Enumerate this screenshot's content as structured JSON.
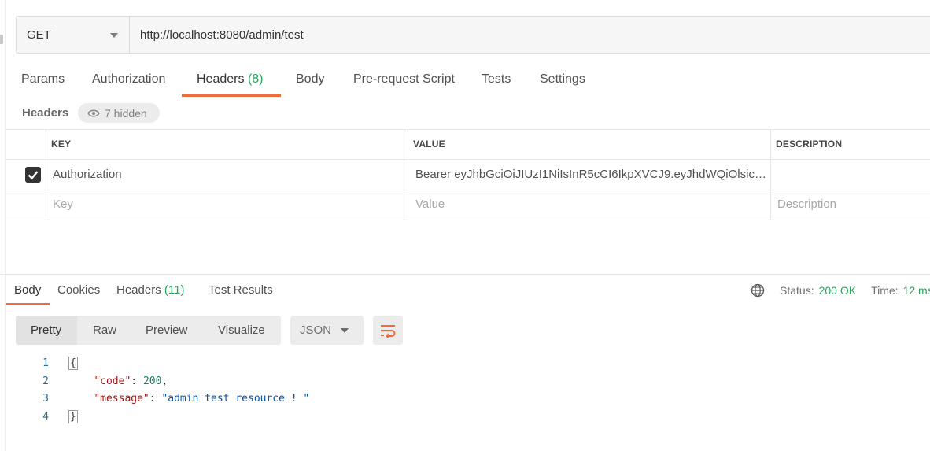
{
  "request": {
    "method": "GET",
    "url": "http://localhost:8080/admin/test"
  },
  "request_tabs": [
    {
      "label": "Params"
    },
    {
      "label": "Authorization"
    },
    {
      "label": "Headers",
      "count": "(8)"
    },
    {
      "label": "Body"
    },
    {
      "label": "Pre-request Script"
    },
    {
      "label": "Tests"
    },
    {
      "label": "Settings"
    }
  ],
  "headers_section": {
    "title": "Headers",
    "hidden_label": "7 hidden",
    "columns": {
      "key": "KEY",
      "value": "VALUE",
      "description": "DESCRIPTION"
    },
    "rows": [
      {
        "key": "Authorization",
        "value": "Bearer eyJhbGciOiJIUzI1NiIsInR5cCI6IkpXVCJ9.eyJhdWQiOlsicm…",
        "description": "",
        "checked": true
      }
    ],
    "placeholders": {
      "key": "Key",
      "value": "Value",
      "description": "Description"
    }
  },
  "response": {
    "tabs": [
      {
        "label": "Body"
      },
      {
        "label": "Cookies"
      },
      {
        "label": "Headers",
        "count": "(11)"
      },
      {
        "label": "Test Results"
      }
    ],
    "status_label": "Status:",
    "status_value": "200 OK",
    "time_label": "Time:",
    "time_value": "12 ms",
    "view_modes": [
      "Pretty",
      "Raw",
      "Preview",
      "Visualize"
    ],
    "format": "JSON",
    "line_numbers": [
      "1",
      "2",
      "3",
      "4"
    ],
    "body": {
      "open": "{",
      "close": "}",
      "code_key": "\"code\"",
      "code_value": "200",
      "message_key": "\"message\"",
      "message_value": "\"admin test resource ! \""
    }
  },
  "colors": {
    "accent": "#f26b3a",
    "success": "#26a65b"
  }
}
